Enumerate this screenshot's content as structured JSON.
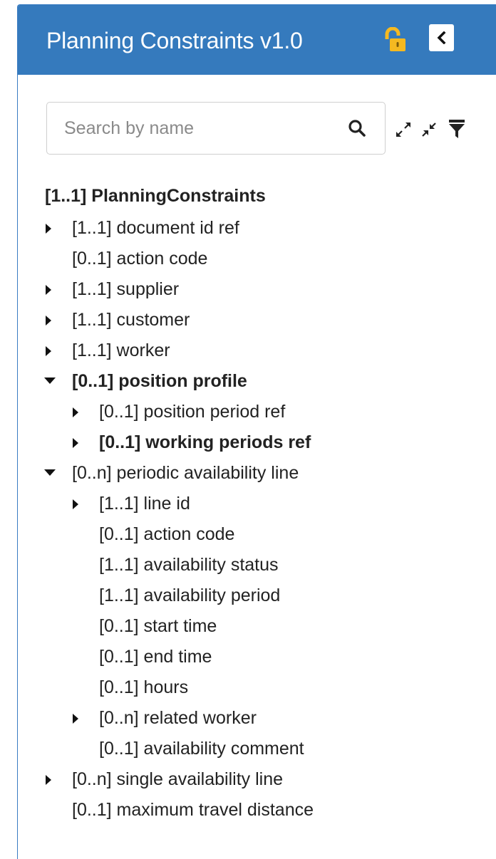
{
  "header": {
    "title": "Planning Constraints v1.0",
    "lock_icon": "unlocked-padlock-icon",
    "collapse_icon": "chevron-left-icon",
    "lock_color": "#f5b921",
    "header_color": "#357abd"
  },
  "search": {
    "placeholder": "Search by name",
    "value": "",
    "icon": "search-icon"
  },
  "toolbar": {
    "expand_all_icon": "expand-arrows-icon",
    "collapse_all_icon": "collapse-arrows-icon",
    "filter_icon": "filter-icon"
  },
  "tree": {
    "root": "[1..1] PlanningConstraints",
    "items": [
      {
        "label": "[1..1] document id ref",
        "level": 1,
        "caret": "right",
        "bold": false
      },
      {
        "label": "[0..1] action code",
        "level": 1,
        "caret": "none",
        "bold": false
      },
      {
        "label": "[1..1] supplier",
        "level": 1,
        "caret": "right",
        "bold": false
      },
      {
        "label": "[1..1] customer",
        "level": 1,
        "caret": "right",
        "bold": false
      },
      {
        "label": "[1..1] worker",
        "level": 1,
        "caret": "right",
        "bold": false
      },
      {
        "label": "[0..1] position profile",
        "level": 1,
        "caret": "down",
        "bold": true
      },
      {
        "label": "[0..1] position period ref",
        "level": 2,
        "caret": "right",
        "bold": false
      },
      {
        "label": "[0..1] working periods ref",
        "level": 2,
        "caret": "right",
        "bold": true
      },
      {
        "label": "[0..n] periodic availability line",
        "level": 1,
        "caret": "down",
        "bold": false
      },
      {
        "label": "[1..1] line id",
        "level": 2,
        "caret": "right",
        "bold": false
      },
      {
        "label": "[0..1] action code",
        "level": 2,
        "caret": "none",
        "bold": false
      },
      {
        "label": "[1..1] availability status",
        "level": 2,
        "caret": "none",
        "bold": false
      },
      {
        "label": "[1..1] availability period",
        "level": 2,
        "caret": "none",
        "bold": false
      },
      {
        "label": "[0..1] start time",
        "level": 2,
        "caret": "none",
        "bold": false
      },
      {
        "label": "[0..1] end time",
        "level": 2,
        "caret": "none",
        "bold": false
      },
      {
        "label": "[0..1] hours",
        "level": 2,
        "caret": "none",
        "bold": false
      },
      {
        "label": "[0..n] related worker",
        "level": 2,
        "caret": "right",
        "bold": false
      },
      {
        "label": "[0..1] availability comment",
        "level": 2,
        "caret": "none",
        "bold": false
      },
      {
        "label": "[0..n] single availability line",
        "level": 1,
        "caret": "right",
        "bold": false
      },
      {
        "label": "[0..1] maximum travel distance",
        "level": 1,
        "caret": "none",
        "bold": false
      }
    ]
  }
}
